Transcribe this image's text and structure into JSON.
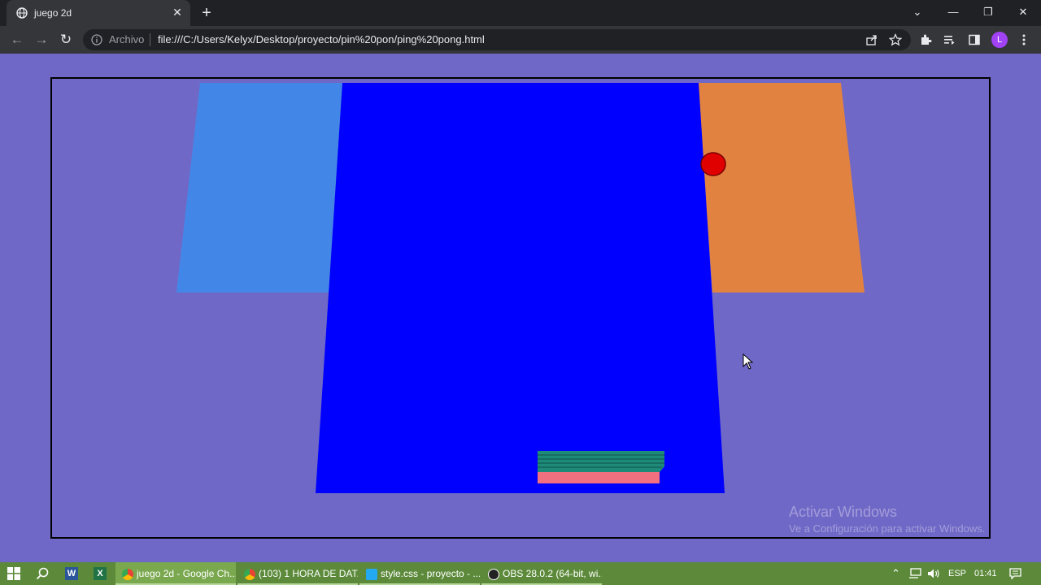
{
  "browser": {
    "tab_title": "juego 2d",
    "new_tab": "+",
    "tab_close": "✕",
    "scheme_label": "Archivo",
    "url": "file:///C:/Users/Kelyx/Desktop/proyecto/pin%20pon/ping%20pong.html",
    "profile_initial": "L"
  },
  "game": {
    "colors": {
      "background": "#7068c6",
      "table": "#0000ff",
      "left_panel": "#4287e8",
      "right_panel": "#e28240",
      "ball": "#e00000",
      "paddle_top": "#1e8a7a",
      "paddle_bottom": "#f07080",
      "border": "#000000"
    }
  },
  "watermark": {
    "line1": "Activar Windows",
    "line2": "Ve a Configuración para activar Windows."
  },
  "taskbar": {
    "items": [
      {
        "label": "juego 2d - Google Ch..."
      },
      {
        "label": "(103) 1 HORA DE DAT..."
      },
      {
        "label": "style.css - proyecto - ..."
      },
      {
        "label": "OBS 28.0.2 (64-bit, wi..."
      }
    ],
    "language": "ESP",
    "time": "01:41"
  }
}
